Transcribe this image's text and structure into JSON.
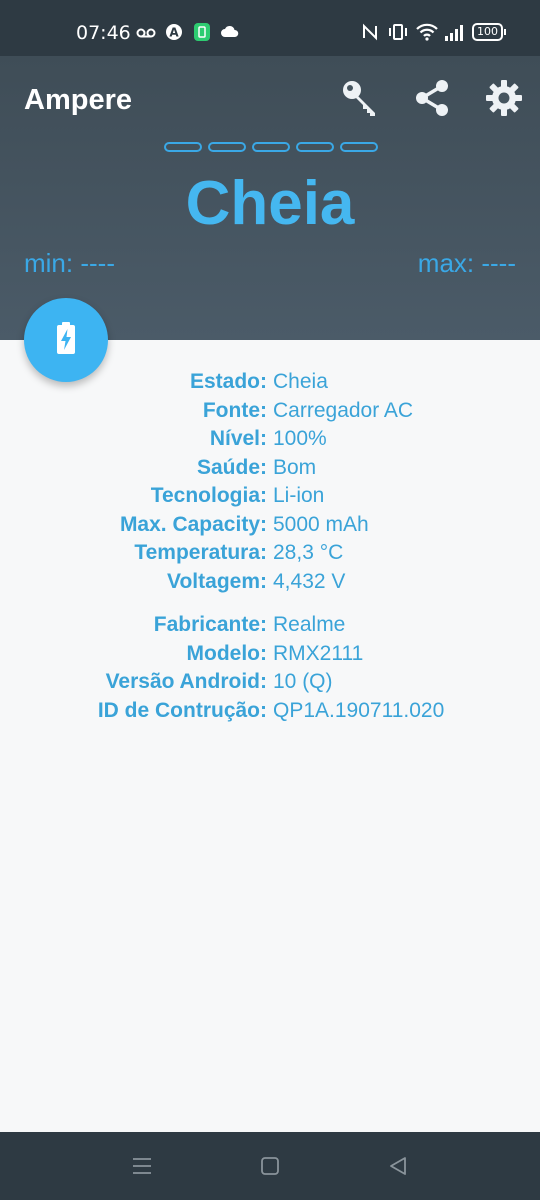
{
  "status_bar": {
    "time": "07:46",
    "left_icons": [
      "voicemail-icon",
      "auto-icon",
      "battery-app-icon",
      "cloud-icon"
    ],
    "right_icons": [
      "nfc-icon",
      "vibrate-icon",
      "wifi-icon",
      "signal-icon",
      "battery-icon"
    ],
    "battery_text": "100"
  },
  "app_bar": {
    "title": "Ampere",
    "actions": [
      "key-icon",
      "share-icon",
      "settings-icon"
    ]
  },
  "header": {
    "status": "Cheia",
    "min": "min: ----",
    "max": "max: ----",
    "accent_color": "#45b7f0"
  },
  "info": {
    "battery": [
      {
        "label": "Estado:",
        "value": "Cheia"
      },
      {
        "label": "Fonte:",
        "value": "Carregador AC"
      },
      {
        "label": "Nível:",
        "value": "100%"
      },
      {
        "label": "Saúde:",
        "value": "Bom"
      },
      {
        "label": "Tecnologia:",
        "value": "Li-ion"
      },
      {
        "label": "Max. Capacity:",
        "value": "5000 mAh"
      },
      {
        "label": "Temperatura:",
        "value": "28,3 °C"
      },
      {
        "label": "Voltagem:",
        "value": "4,432 V"
      }
    ],
    "device": [
      {
        "label": "Fabricante:",
        "value": "Realme"
      },
      {
        "label": "Modelo:",
        "value": "RMX2111"
      },
      {
        "label": "Versão Android:",
        "value": "10 (Q)"
      },
      {
        "label": "ID de Contrução:",
        "value": "QP1A.190711.020"
      }
    ]
  },
  "nav_bar": {
    "buttons": [
      "menu-icon",
      "home-icon",
      "back-icon"
    ]
  }
}
